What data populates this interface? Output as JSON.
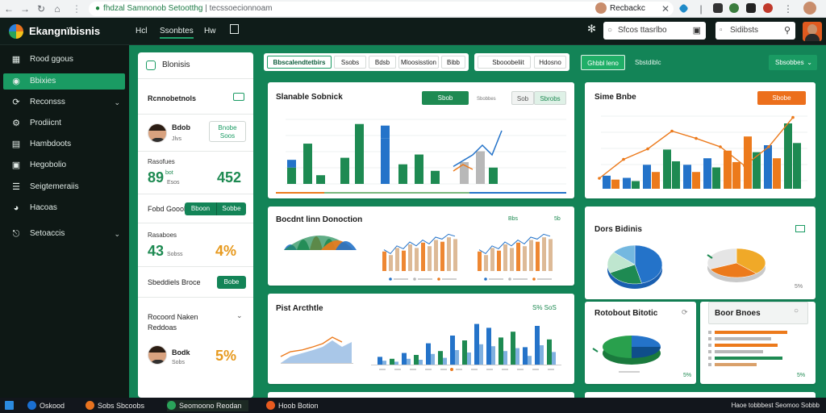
{
  "browser": {
    "url_domain": "fhdzal Samnonob Setootthg",
    "url_path": "| tecssoecionnoam",
    "profile_name": "Recbackc"
  },
  "app": {
    "name": "Ekangnïbisnis",
    "topnav": [
      "Hcl",
      "Ssonbtes",
      "Hw"
    ],
    "search1_placeholder": "Sfcos ttasrlbo",
    "search2_placeholder": "Sidibsts"
  },
  "sidebar": {
    "items": [
      {
        "label": "Rood ggous",
        "icon": "grid-icon"
      },
      {
        "label": "Bbixies",
        "icon": "dashboard-icon",
        "active": true
      },
      {
        "label": "Reconsss",
        "icon": "refresh-icon",
        "chevron": true
      },
      {
        "label": "Prodiicnt",
        "icon": "settings-icon"
      },
      {
        "label": "Hambdoots",
        "icon": "document-icon"
      },
      {
        "label": "Hegobolio",
        "icon": "folder-icon"
      },
      {
        "label": "Seigtemeraiis",
        "icon": "list-icon"
      },
      {
        "label": "Hacoas",
        "icon": "globe-icon"
      },
      {
        "label": "Setoaccis",
        "icon": "export-icon",
        "chevron": true
      }
    ]
  },
  "left_panel": {
    "title": "Blonisis",
    "section1": "Rcnnobetnols",
    "user1_name": "Bdob",
    "user1_sub": "Jlvs",
    "user1_btn": "Bnobe\nSoos",
    "stat1_label": "Rasofues",
    "stat1_value": "89",
    "stat1_unit": "bot",
    "stat1_sub": "Esos",
    "stat2_value": "452",
    "row3_label": "Fobd Gooob",
    "row3_btn1": "Bboon",
    "row3_btn2": "Sobbe",
    "stat3_label": "Rasaboes",
    "stat3_value": "43",
    "stat3_sub": "Sobss",
    "stat4_value": "4%",
    "row5_label": "Sbeddiels Broce",
    "row5_btn": "Bobe",
    "section6_line1": "Rocoord Naken",
    "section6_line2": "Reddoas",
    "user2_name": "Bodk",
    "user2_sub": "Sobs",
    "stat5_value": "5%"
  },
  "tabs": {
    "group1": [
      "Bbscalendtetbirs",
      "Ssobs",
      "Bdsb",
      "Mloosisstion",
      "Bibb"
    ],
    "group2": [
      "Sbooobeliit",
      "Hdosno"
    ],
    "primary_button": "Ghbbl leno",
    "trailing_link": "Sbstdiblc",
    "dropdown": "Sbsobbes"
  },
  "cards": {
    "c1_title": "Slanable Sobnick",
    "c1_btn": "Sbob",
    "c1_toggle": [
      "Sob",
      "Sbrobs"
    ],
    "c1_link": "Sbobbes",
    "c2_title": "Sime Bnbe",
    "c2_btn": "Sbobe",
    "c3_title": "Bocdnt linn Donoction",
    "c3_badge1": "Bbs",
    "c3_badge2": "5b",
    "c4_title": "Dors Bidinis",
    "c4_pct": "5%",
    "c5_title": "Pist Arcthtle",
    "c5_badge": "S% SoS",
    "c6_title": "Rotobout Bitotic",
    "c6_pct": "5%",
    "c7_title": "Boor Bnoes",
    "c7_pct": "5%",
    "legend_labels": [
      "Bdoobcis",
      "Sbbe",
      "Bbs"
    ]
  },
  "chart_data": [
    {
      "type": "bar",
      "id": "c1_groups",
      "series": [
        {
          "name": "",
          "values": [
            15,
            37,
            8,
            24,
            55,
            42,
            18,
            27,
            12,
            20,
            30,
            15
          ]
        },
        {
          "name": "",
          "values": [
            8,
            0,
            0,
            0,
            0,
            13,
            0,
            0,
            0,
            0,
            0,
            0
          ]
        }
      ]
    },
    {
      "type": "line",
      "id": "c2_line",
      "values": [
        10,
        28,
        38,
        55,
        48,
        40,
        22,
        40,
        68
      ]
    },
    {
      "type": "bar",
      "id": "c2_bars",
      "values": [
        12,
        10,
        22,
        36,
        22,
        28,
        35,
        48,
        40,
        60
      ]
    },
    {
      "type": "area",
      "id": "c3_area",
      "values": [
        14,
        26,
        34,
        28,
        15
      ]
    },
    {
      "type": "bar",
      "id": "c3_bars",
      "values": [
        22,
        18,
        26,
        23,
        30,
        26,
        32,
        28,
        35,
        33,
        38,
        36
      ]
    },
    {
      "type": "bar",
      "id": "c5_bars",
      "values": [
        8,
        6,
        12,
        10,
        22,
        14,
        30,
        25,
        42,
        38,
        28,
        34,
        18,
        40,
        26
      ]
    },
    {
      "type": "pie",
      "id": "c4_pie",
      "values": [
        46,
        22,
        18,
        14
      ]
    },
    {
      "type": "bar",
      "id": "c7_bars",
      "values": [
        90,
        70,
        78,
        60,
        84,
        52
      ]
    }
  ],
  "taskbar": {
    "items": [
      "Oskood",
      "Sobs Sbcoobs",
      "Seomoono Reodan",
      "Hoob Botion"
    ],
    "clock": "Haoe tobbbest Seomoo Sobbb"
  },
  "colors": {
    "accent": "#138457",
    "green": "#1e8a52",
    "blue": "#2473c9",
    "orange": "#ec7a1c",
    "gray": "#b8b8b8"
  }
}
